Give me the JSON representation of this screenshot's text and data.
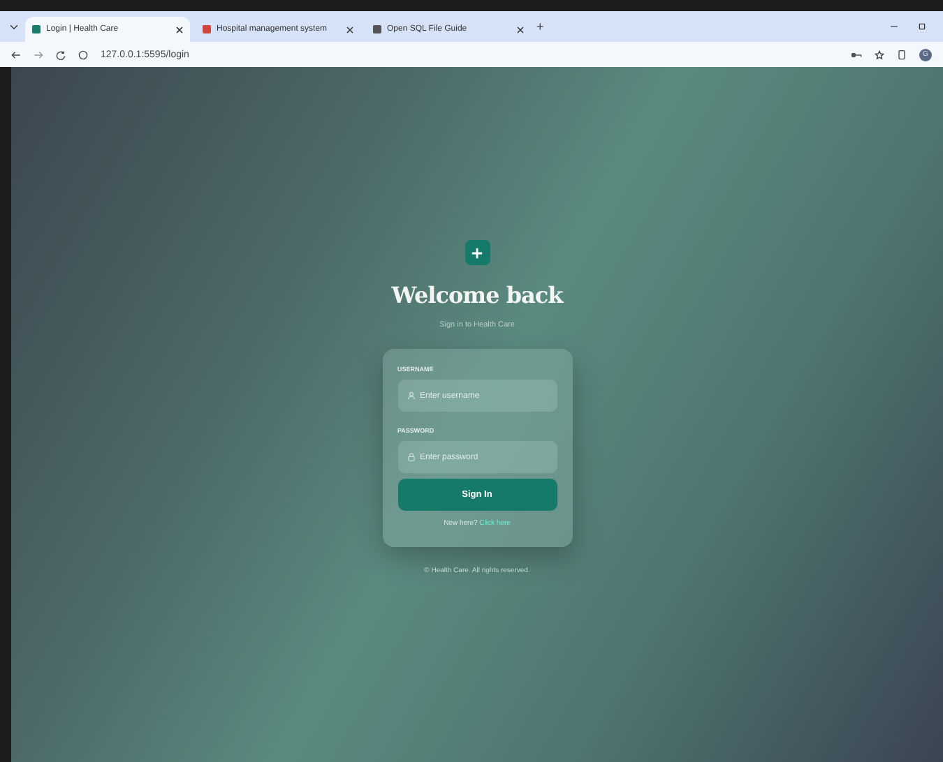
{
  "browser": {
    "tabs": [
      {
        "title": "Login | Health Care",
        "selected": true
      },
      {
        "title": "Hospital management system",
        "selected": false
      },
      {
        "title": "Open SQL File Guide",
        "selected": false
      }
    ],
    "new_tab": "+",
    "url": "127.0.0.1:5595/login",
    "profile": "G"
  },
  "login": {
    "title": "Welcome back",
    "subtitle": "Sign in to Health Care",
    "fields": [
      {
        "label": "USERNAME",
        "placeholder": "Enter username",
        "kind": "user"
      },
      {
        "label": "PASSWORD",
        "placeholder": "Enter password",
        "kind": "lock"
      }
    ],
    "submit": "Sign In",
    "prompt": "New here?",
    "link": "Click here"
  },
  "footer": "© Health Care. All rights reserved."
}
